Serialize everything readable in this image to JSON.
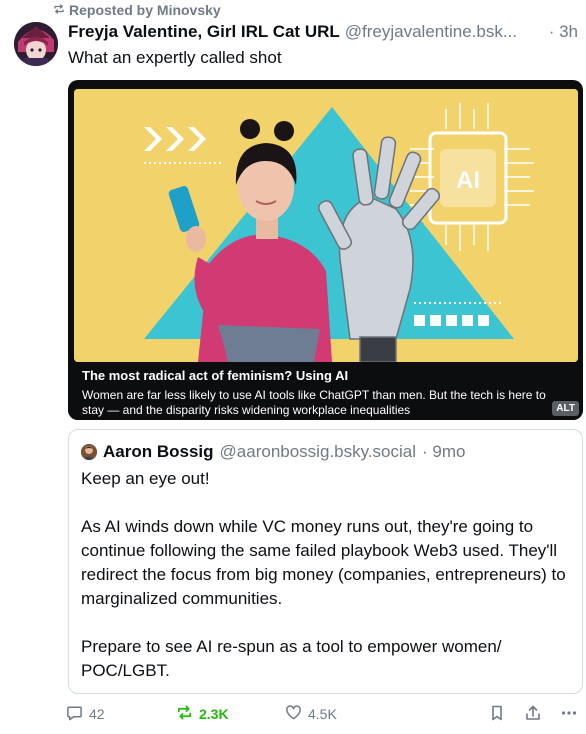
{
  "repost": {
    "label": "Reposted by Minovsky"
  },
  "post": {
    "author": "Freyja Valentine, Girl IRL Cat URL",
    "handle": "@freyjavalentine.bsk",
    "handle_ellipsis": "...",
    "time": "· 3h",
    "text": "What an expertly called shot"
  },
  "embed": {
    "title": "The most radical act of feminism? Using AI",
    "description": "Women are far less likely to use AI tools like ChatGPT than men. But the tech is here to stay — and the disparity risks widening workplace inequalities",
    "alt_badge": "ALT",
    "image_chip_text": "AI"
  },
  "quote": {
    "author": "Aaron Bossig",
    "handle": "@aaronbossig.bsky.social",
    "time": "· 9mo",
    "paragraphs": [
      "Keep an eye out!",
      "As AI winds down while VC money runs out, they're going to continue following the same failed playbook Web3 used.  They'll redirect the focus from big money (companies, entrepreneurs) to marginalized communities.",
      "Prepare to see AI re-spun as a tool to empower women/ POC/LGBT."
    ]
  },
  "actions": {
    "replies": "42",
    "reposts": "2.3K",
    "likes": "4.5K"
  },
  "colors": {
    "muted": "#6f7a86",
    "repost_active": "#20bc07",
    "border": "#d4dbe2",
    "image_bg": "#f2d36b",
    "triangle": "#3cc4d2",
    "sweater": "#d23a74"
  },
  "icons": [
    "repost-icon",
    "reply-icon",
    "like-icon",
    "bookmark-icon",
    "share-icon",
    "more-icon"
  ]
}
